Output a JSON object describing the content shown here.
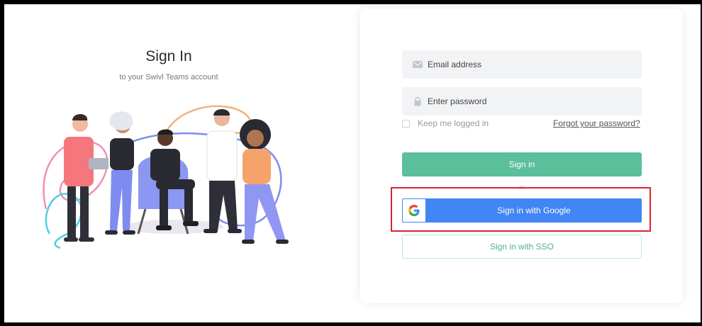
{
  "left": {
    "title": "Sign In",
    "subtitle": "to your Swivl Teams account",
    "illustration": "team-of-people-illustration"
  },
  "form": {
    "email_placeholder": "Email address",
    "password_placeholder": "Enter password",
    "email_icon": "envelope-icon",
    "password_icon": "lock-icon",
    "remember_label": "Keep me logged in",
    "remember_checked": false,
    "forgot_link": "Forgot your password?",
    "signin_button": "Sign in",
    "or_separator": "or",
    "google_button": "Sign in with Google",
    "sso_button": "Sign in with SSO"
  },
  "colors": {
    "primary_green": "#5bbf9c",
    "google_blue": "#4285f4",
    "highlight_red": "#d9232d"
  }
}
